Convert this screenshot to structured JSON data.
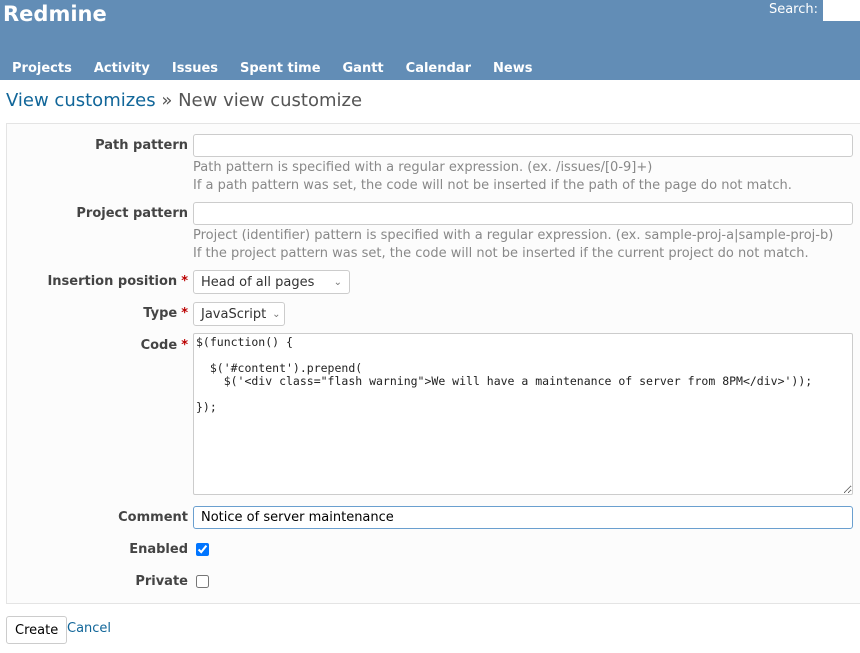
{
  "header": {
    "title": "Redmine",
    "search_label": "Search:"
  },
  "nav": [
    "Projects",
    "Activity",
    "Issues",
    "Spent time",
    "Gantt",
    "Calendar",
    "News"
  ],
  "breadcrumb": {
    "parent": "View customizes",
    "separator": " » ",
    "current": "New view customize"
  },
  "form": {
    "path_pattern": {
      "label": "Path pattern",
      "value": "",
      "hint1": "Path pattern is specified with a regular expression. (ex. /issues/[0-9]+)",
      "hint2": "If a path pattern was set, the code will not be inserted if the path of the page do not match."
    },
    "project_pattern": {
      "label": "Project pattern",
      "value": "",
      "hint1": "Project (identifier) pattern is specified with a regular expression. (ex. sample-proj-a|sample-proj-b)",
      "hint2": "If the project pattern was set, the code will not be inserted if the current project do not match."
    },
    "insertion_position": {
      "label": "Insertion position",
      "value": "Head of all pages"
    },
    "type": {
      "label": "Type",
      "value": "JavaScript"
    },
    "code": {
      "label": "Code",
      "value": "$(function() {\n\n  $('#content').prepend(\n    $('<div class=\"flash warning\">We will have a maintenance of server from 8PM</div>'));\n\n});"
    },
    "comment": {
      "label": "Comment",
      "value": "Notice of server maintenance"
    },
    "enabled": {
      "label": "Enabled",
      "checked": true
    },
    "private": {
      "label": "Private",
      "checked": false
    },
    "required_mark": "*"
  },
  "actions": {
    "create": "Create",
    "cancel": "Cancel"
  },
  "colors": {
    "header": "#628db6",
    "link": "#116699",
    "required": "#bb0000"
  }
}
